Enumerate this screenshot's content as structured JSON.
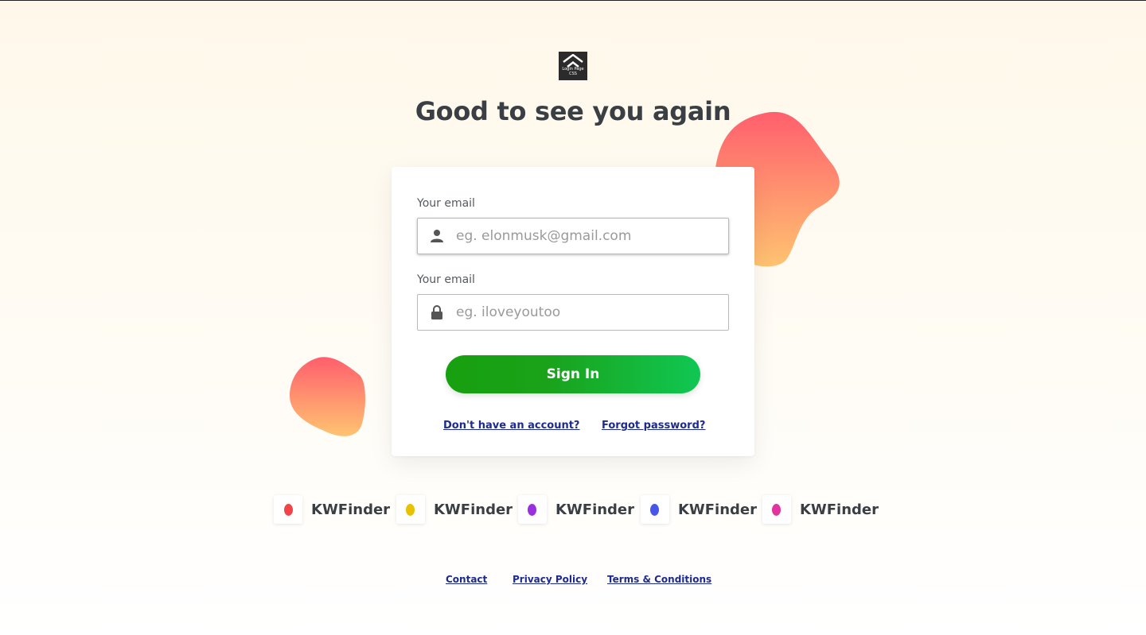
{
  "logo": {
    "caption_line1": "Login Page",
    "caption_line2": "CSS"
  },
  "heading": "Good to see you again",
  "form": {
    "email_label": "Your email",
    "email_placeholder": "eg. elonmusk@gmail.com",
    "password_label": "Your email",
    "password_placeholder": "eg. iloveyoutoo",
    "signin_label": "Sign In",
    "signup_link": "Don't have an account?",
    "forgot_link": "Forgot password?"
  },
  "brands": [
    {
      "name": "KWFinder",
      "color": "#f0434a"
    },
    {
      "name": "KWFinder",
      "color": "#e8c200"
    },
    {
      "name": "KWFinder",
      "color": "#9b2fe0"
    },
    {
      "name": "KWFinder",
      "color": "#4657e8"
    },
    {
      "name": "KWFinder",
      "color": "#e0359f"
    }
  ],
  "footer": {
    "contact": "Contact",
    "privacy": "Privacy Policy",
    "terms": "Terms & Conditions"
  },
  "colors": {
    "accent_start": "#17a00f",
    "accent_end": "#10c753",
    "blob_top": "#ff5f6d",
    "blob_bottom": "#ffc371",
    "link": "#1d2a8f"
  }
}
